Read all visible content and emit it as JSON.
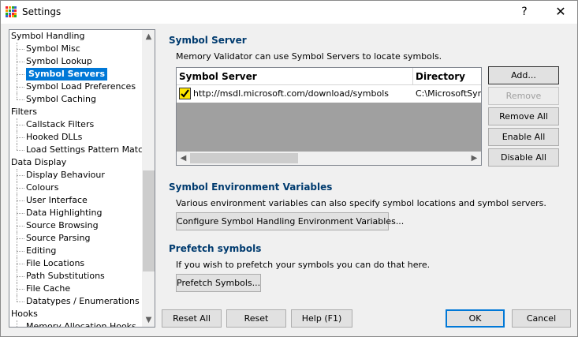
{
  "window": {
    "title": "Settings",
    "help_glyph": "?",
    "close_glyph": "✕"
  },
  "tree": {
    "items": [
      {
        "label": "Symbol Handling",
        "level": 0
      },
      {
        "label": "Symbol Misc",
        "level": 1
      },
      {
        "label": "Symbol Lookup",
        "level": 1
      },
      {
        "label": "Symbol Servers",
        "level": 1,
        "selected": true
      },
      {
        "label": "Symbol Load Preferences",
        "level": 1
      },
      {
        "label": "Symbol Caching",
        "level": 1
      },
      {
        "label": "Filters",
        "level": 0
      },
      {
        "label": "Callstack Filters",
        "level": 1
      },
      {
        "label": "Hooked DLLs",
        "level": 1
      },
      {
        "label": "Load Settings Pattern Match",
        "level": 1
      },
      {
        "label": "Data Display",
        "level": 0
      },
      {
        "label": "Display Behaviour",
        "level": 1
      },
      {
        "label": "Colours",
        "level": 1
      },
      {
        "label": "User Interface",
        "level": 1
      },
      {
        "label": "Data Highlighting",
        "level": 1
      },
      {
        "label": "Source Browsing",
        "level": 1
      },
      {
        "label": "Source Parsing",
        "level": 1
      },
      {
        "label": "Editing",
        "level": 1
      },
      {
        "label": "File Locations",
        "level": 1
      },
      {
        "label": "Path Substitutions",
        "level": 1
      },
      {
        "label": "File Cache",
        "level": 1
      },
      {
        "label": "Datatypes / Enumerations",
        "level": 1
      },
      {
        "label": "Hooks",
        "level": 0
      },
      {
        "label": "Memory Allocation Hooks",
        "level": 1
      }
    ]
  },
  "symbol_server": {
    "title": "Symbol Server",
    "description": "Memory Validator can use Symbol Servers to locate symbols.",
    "columns": [
      "Symbol Server",
      "Directory"
    ],
    "rows": [
      {
        "checked": true,
        "server": "http://msdl.microsoft.com/download/symbols",
        "directory": "C:\\MicrosoftSym"
      }
    ],
    "buttons": {
      "add": "Add...",
      "remove": "Remove",
      "remove_all": "Remove All",
      "enable_all": "Enable All",
      "disable_all": "Disable All"
    }
  },
  "env_vars": {
    "title": "Symbol Environment Variables",
    "description": "Various environment variables can also specify symbol locations and symbol servers.",
    "button": "Configure Symbol Handling Environment Variables..."
  },
  "prefetch": {
    "title": "Prefetch symbols",
    "description": "If you wish to prefetch your symbols you can do that here.",
    "button": "Prefetch Symbols..."
  },
  "footer": {
    "reset_all": "Reset All",
    "reset": "Reset",
    "help": "Help (F1)",
    "ok": "OK",
    "cancel": "Cancel"
  },
  "colors": {
    "accent": "#0078d7",
    "section_title": "#003b6f",
    "checkbox": "#ffe500"
  }
}
